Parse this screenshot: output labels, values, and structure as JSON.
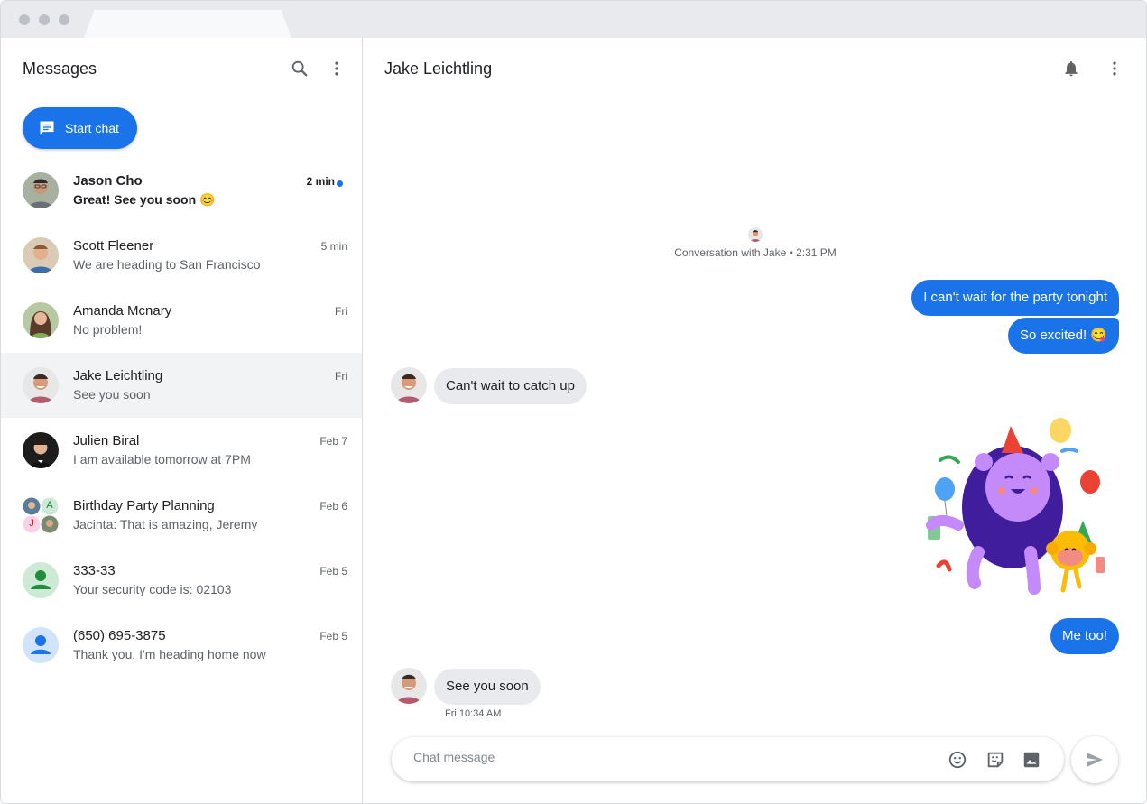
{
  "sidebar": {
    "title": "Messages",
    "start_chat_label": "Start chat",
    "conversations": [
      {
        "name": "Jason Cho",
        "snippet": "Great! See you soon 😊",
        "time": "2 min",
        "unread": true
      },
      {
        "name": "Scott Fleener",
        "snippet": "We are heading to San Francisco",
        "time": "5 min"
      },
      {
        "name": "Amanda Mcnary",
        "snippet": "No problem!",
        "time": "Fri"
      },
      {
        "name": "Jake Leichtling",
        "snippet": "See you soon",
        "time": "Fri",
        "selected": true
      },
      {
        "name": "Julien Biral",
        "snippet": "I am available tomorrow at 7PM",
        "time": "Feb 7"
      },
      {
        "name": "Birthday Party Planning",
        "snippet": "Jacinta: That is amazing, Jeremy",
        "time": "Feb 6",
        "group_initials": [
          "A",
          "J"
        ]
      },
      {
        "name": "333-33",
        "snippet": "Your security code is: 02103",
        "time": "Feb 5"
      },
      {
        "name": "(650) 695-3875",
        "snippet": "Thank you. I'm heading home now",
        "time": "Feb 5"
      }
    ]
  },
  "chat": {
    "title": "Jake Leichtling",
    "conversation_info": "Conversation with Jake • 2:31 PM",
    "messages": [
      {
        "direction": "out",
        "text": "I can't wait for the party tonight"
      },
      {
        "direction": "out",
        "text": "So excited! 😋"
      },
      {
        "direction": "in",
        "text": "Can't wait to catch up"
      },
      {
        "direction": "out",
        "sticker": "party-monsters-sticker"
      },
      {
        "direction": "out",
        "text": "Me too!"
      },
      {
        "direction": "in",
        "text": "See you soon",
        "timestamp": "Fri 10:34 AM"
      }
    ],
    "compose_placeholder": "Chat message",
    "compose_value": ""
  },
  "icons": {
    "search": "search-icon",
    "more": "more-vert-icon",
    "bell": "notifications-icon",
    "emoji": "emoji-icon",
    "sticker": "sticker-icon",
    "image": "image-icon",
    "send": "send-icon",
    "chat": "chat-icon"
  },
  "colors": {
    "accent": "#1a73e8",
    "incoming_bubble": "#e8eaed",
    "selected_row": "#f1f3f4"
  }
}
